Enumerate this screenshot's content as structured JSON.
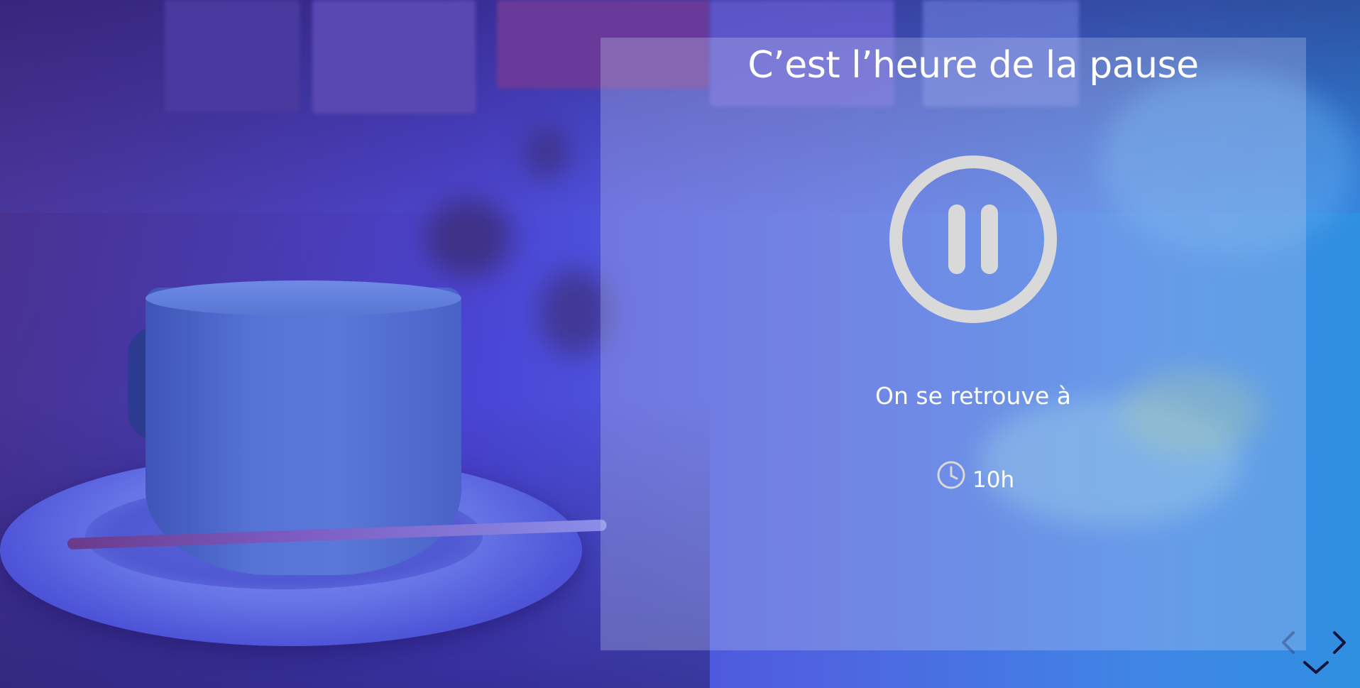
{
  "slide": {
    "title": "C’est l’heure de la pause",
    "subtitle": "On se retrouve à",
    "time": "10h"
  },
  "icons": {
    "pause": "pause-circle-icon",
    "clock": "clock-icon",
    "prev": "chevron-left-icon",
    "next": "chevron-right-icon",
    "down": "chevron-down-icon"
  },
  "colors": {
    "icon_gray": "#d9d9d9",
    "text": "#ffffff",
    "nav": "#1a1a3a"
  }
}
